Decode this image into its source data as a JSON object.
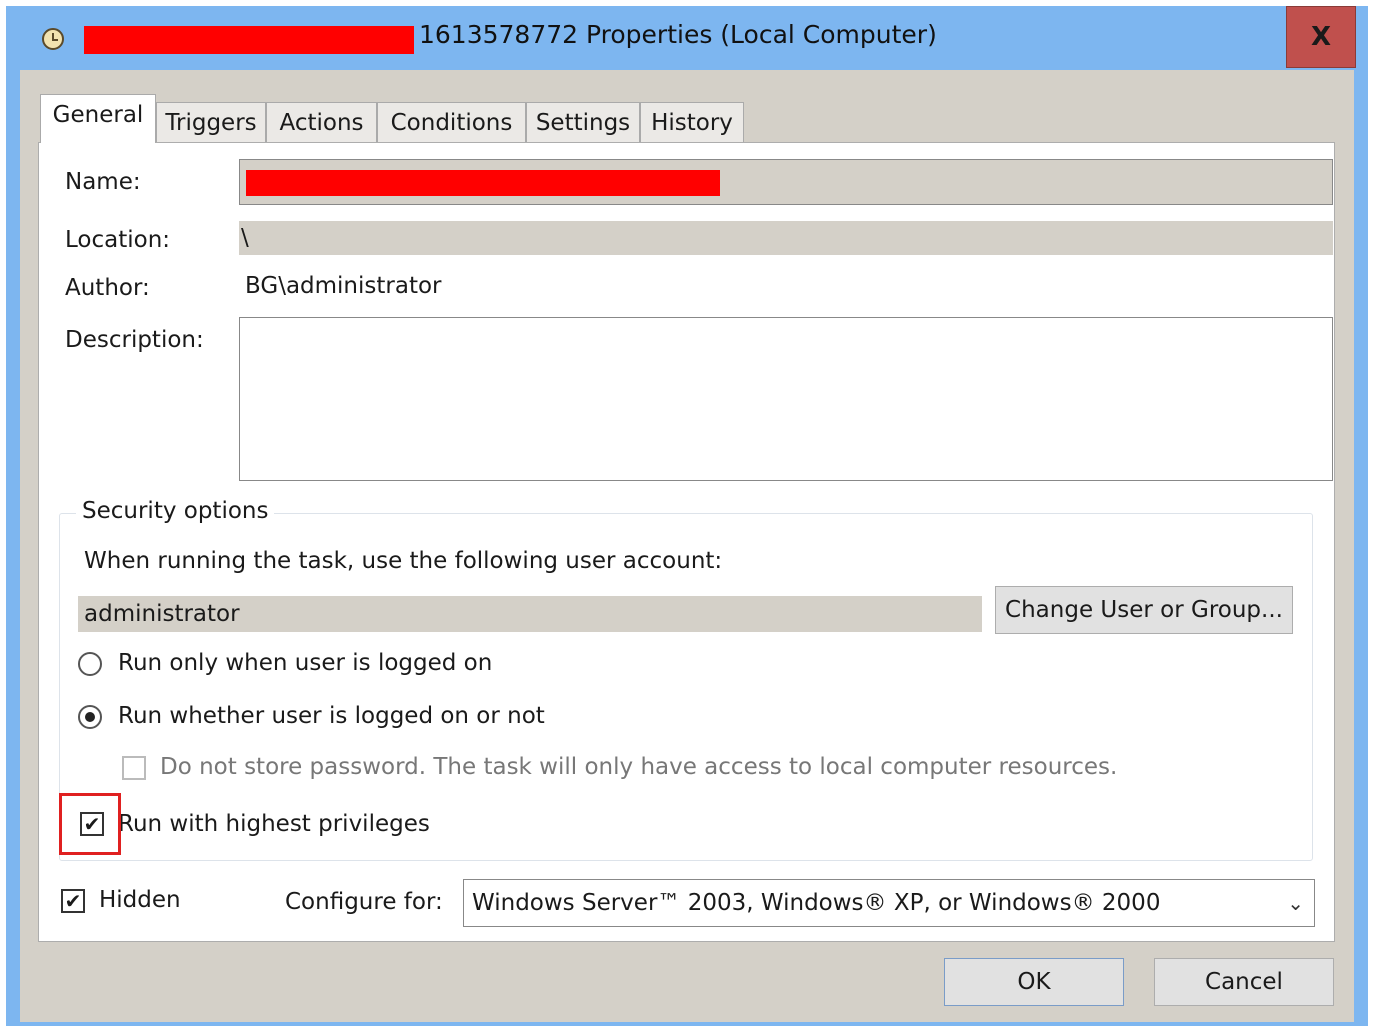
{
  "window": {
    "title": "1613578772 Properties (Local Computer)",
    "close_label": "X"
  },
  "tabs": [
    {
      "label": "General"
    },
    {
      "label": "Triggers"
    },
    {
      "label": "Actions"
    },
    {
      "label": "Conditions"
    },
    {
      "label": "Settings"
    },
    {
      "label": "History"
    }
  ],
  "general": {
    "name_label": "Name:",
    "location_label": "Location:",
    "location_value": "\\",
    "author_label": "Author:",
    "author_value": "BG\\administrator",
    "description_label": "Description:"
  },
  "security": {
    "title": "Security options",
    "account_prompt": "When running the task, use the following user account:",
    "account_value": "administrator",
    "change_user_button": "Change User or Group...",
    "radio_logged_on": "Run only when user is logged on",
    "radio_whether": "Run whether user is logged on or not",
    "no_store_password": "Do not store password.  The task will only have access to local computer resources.",
    "highest_privileges": "Run with highest privileges"
  },
  "footer": {
    "hidden_label": "Hidden",
    "configure_label": "Configure for:",
    "configure_value": "Windows Server™ 2003, Windows® XP, or Windows® 2000",
    "ok_button": "OK",
    "cancel_button": "Cancel"
  },
  "state": {
    "run_whether_selected": true,
    "highest_privileges_checked": true,
    "hidden_checked": true,
    "no_store_password_checked": false
  },
  "colors": {
    "titlebar": "#7db6f0",
    "close": "#c0504d",
    "redaction": "#ff0000",
    "highlight": "#e02020"
  }
}
